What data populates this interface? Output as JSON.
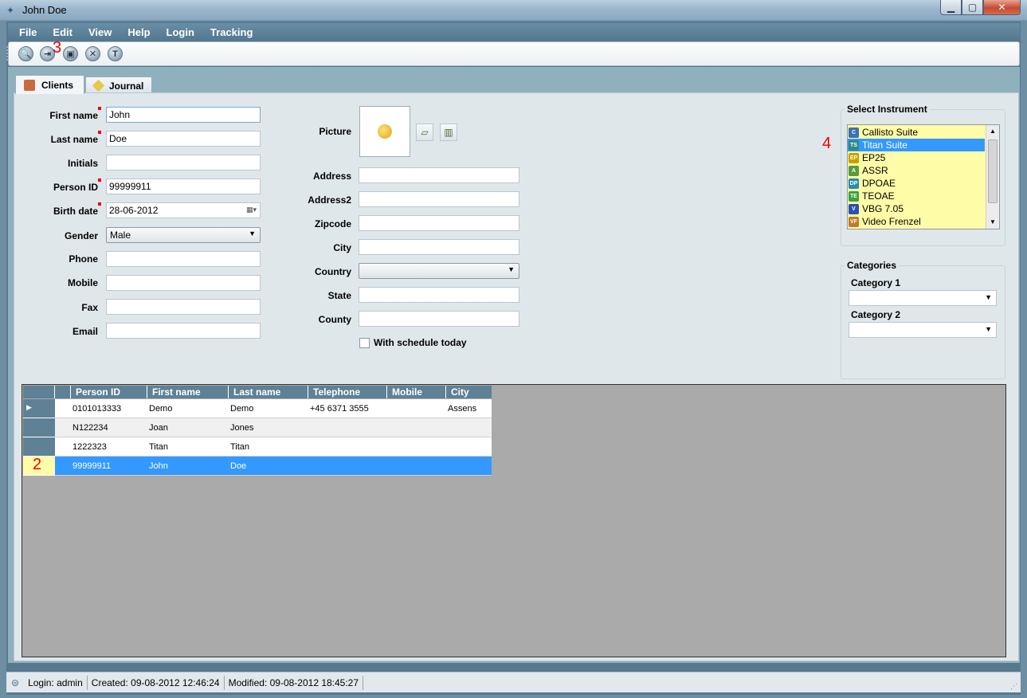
{
  "window": {
    "title": "John  Doe",
    "min": "▁",
    "max": "▢",
    "close": "✕"
  },
  "menu": [
    "File",
    "Edit",
    "View",
    "Help",
    "Login",
    "Tracking"
  ],
  "toolbar": {
    "search": "🔍",
    "import": "⇥",
    "save": "▣",
    "delete": "✕",
    "text": "T"
  },
  "annotations": {
    "a3": "3",
    "a2": "2",
    "a4": "4"
  },
  "tabs": {
    "clients": "Clients",
    "journal": "Journal"
  },
  "form": {
    "first_name": {
      "label": "First name",
      "value": "John"
    },
    "last_name": {
      "label": "Last name",
      "value": "Doe"
    },
    "initials": {
      "label": "Initials",
      "value": ""
    },
    "person_id": {
      "label": "Person ID",
      "value": "99999911"
    },
    "birth_date": {
      "label": "Birth date",
      "value": "28-06-2012"
    },
    "gender": {
      "label": "Gender",
      "value": "Male"
    },
    "phone": {
      "label": "Phone",
      "value": ""
    },
    "mobile": {
      "label": "Mobile",
      "value": ""
    },
    "fax": {
      "label": "Fax",
      "value": ""
    },
    "email": {
      "label": "Email",
      "value": ""
    },
    "picture": {
      "label": "Picture"
    },
    "address": {
      "label": "Address",
      "value": ""
    },
    "address2": {
      "label": "Address2",
      "value": ""
    },
    "zipcode": {
      "label": "Zipcode",
      "value": ""
    },
    "city": {
      "label": "City",
      "value": ""
    },
    "country": {
      "label": "Country",
      "value": ""
    },
    "state": {
      "label": "State",
      "value": ""
    },
    "county": {
      "label": "County",
      "value": ""
    },
    "schedule": {
      "label": "With schedule today",
      "checked": false
    }
  },
  "instruments": {
    "title": "Select Instrument",
    "items": [
      {
        "label": "Callisto Suite",
        "icon": "callisto-icon",
        "color": "#3a6fb0",
        "glyph": "C"
      },
      {
        "label": "Titan Suite",
        "icon": "titan-icon",
        "color": "#2d8a8a",
        "glyph": "TS"
      },
      {
        "label": "EP25",
        "icon": "ep25-icon",
        "color": "#c8a000",
        "glyph": "EP"
      },
      {
        "label": "ASSR",
        "icon": "assr-icon",
        "color": "#5a9a3a",
        "glyph": "A"
      },
      {
        "label": "DPOAE",
        "icon": "dpoae-icon",
        "color": "#2a8ab0",
        "glyph": "DP"
      },
      {
        "label": "TEOAE",
        "icon": "teoae-icon",
        "color": "#3aa040",
        "glyph": "TE"
      },
      {
        "label": "VBG 7.05",
        "icon": "vbg-icon",
        "color": "#2a50b0",
        "glyph": "V"
      },
      {
        "label": "Video Frenzel",
        "icon": "video-frenzel-icon",
        "color": "#c07a30",
        "glyph": "VF"
      }
    ],
    "selected": 1
  },
  "categories": {
    "title": "Categories",
    "cat1": "Category 1",
    "cat2": "Category 2"
  },
  "grid": {
    "columns": [
      "Person ID",
      "First name",
      "Last name",
      "Telephone",
      "Mobile",
      "City"
    ],
    "rows": [
      [
        "0101013333",
        "Demo",
        "Demo",
        "+45 6371 3555",
        "",
        "Assens"
      ],
      [
        "N122234",
        "Joan",
        "Jones",
        "",
        "",
        ""
      ],
      [
        "1222323",
        "Titan",
        "Titan",
        "",
        "",
        ""
      ],
      [
        "99999911",
        "John",
        "Doe",
        "",
        "",
        ""
      ]
    ],
    "selected_row": 3
  },
  "status": {
    "login": "Login: admin",
    "created": "Created: 09-08-2012 12:46:24",
    "modified": "Modified:  09-08-2012 18:45:27"
  },
  "colors": {
    "accent": "#3399ff",
    "menu_bg": "#5e8195",
    "instrument_bg": "#fffca8"
  }
}
